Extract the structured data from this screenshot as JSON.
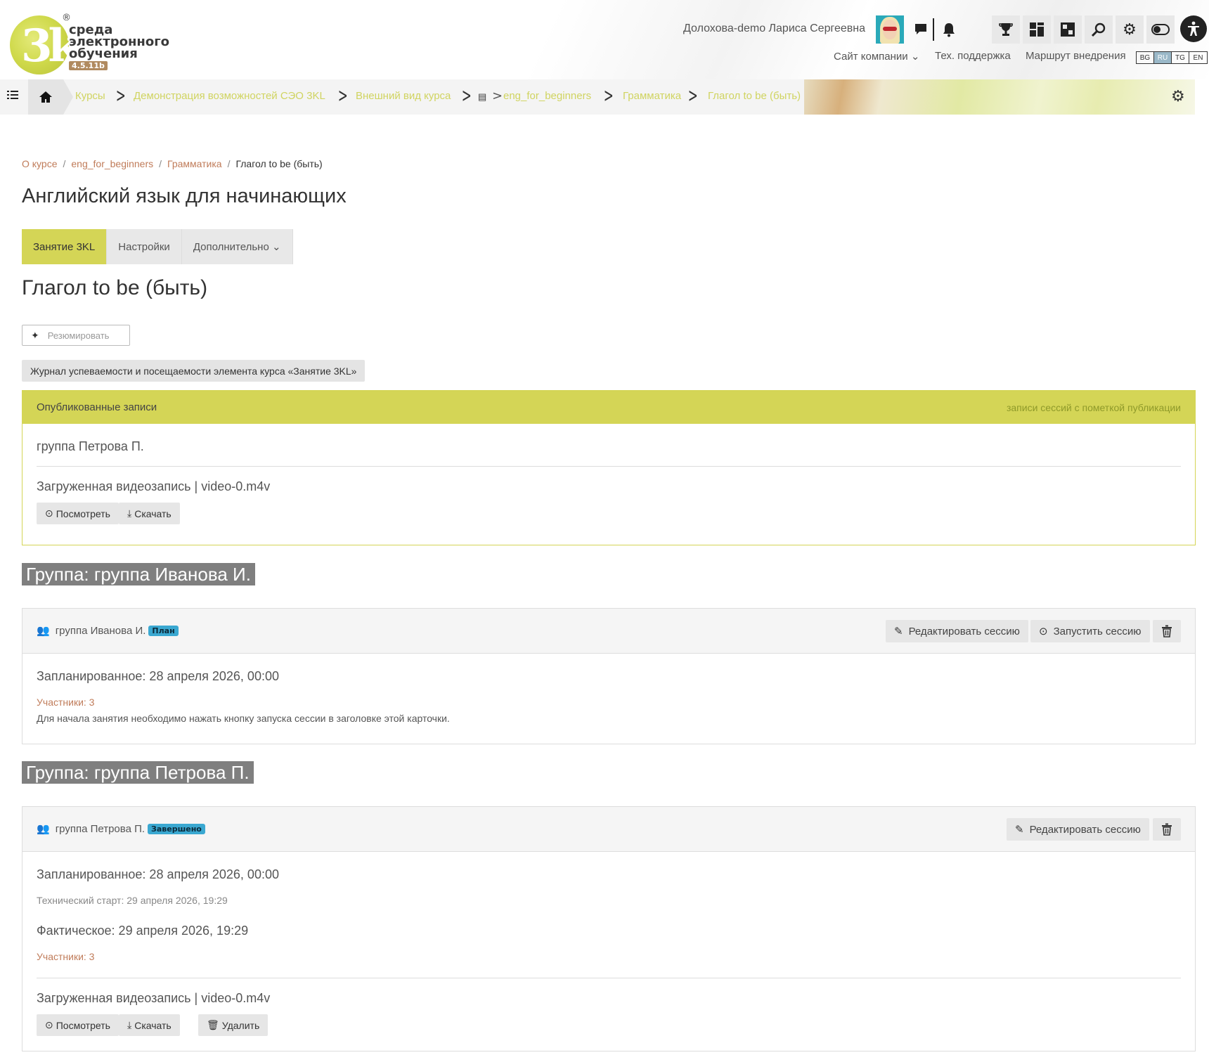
{
  "header": {
    "logo_text_line1": "среда",
    "logo_text_line2": "электронного",
    "logo_text_line3": "обучения",
    "logo_mark": "3k",
    "logo_reg": "®",
    "version": "4.5.11b",
    "user_name": "Долохова-demo Лариса Сергеевна",
    "links": {
      "company_site": "Сайт компании ⌄",
      "support": "Тех. поддержка",
      "route": "Маршрут внедрения"
    },
    "languages": [
      "BG",
      "RU",
      "TG",
      "EN"
    ],
    "active_language": "RU"
  },
  "crumbbar": {
    "items": [
      "Курсы",
      "Демонстрация возможностей СЭО 3KL",
      "Внешний вид курса",
      "eng_for_beginners",
      "Грамматика",
      "Глагол to be (быть)"
    ]
  },
  "page": {
    "breadcrumb": [
      "О курсе",
      "eng_for_beginners",
      "Грамматика",
      "Глагол to be (быть)"
    ],
    "breadcrumb_sep": "/",
    "course_title": "Английский язык для начинающих",
    "tabs": [
      "Занятие 3KL",
      "Настройки",
      "Дополнительно ⌄"
    ],
    "lesson_title": "Глагол to be (быть)",
    "summarize_label": "Резюмировать",
    "journal_label": "Журнал успеваемости и посещаемости элемента курса «Занятие 3KL»"
  },
  "published": {
    "title": "Опубликованные записи",
    "subtitle": "записи сессий с пометкой публикации",
    "group": "группа Петрова П.",
    "video_label": "Загруженная видеозапись | video-0.m4v",
    "view_label": "Посмотреть",
    "download_label": "Скачать"
  },
  "groups": [
    {
      "heading": "Группа: группа Иванова И.",
      "name": "группа Иванова И.",
      "badge": "План",
      "edit_label": "Редактировать сессию",
      "start_label": "Запустить сессию",
      "planned": "Запланированное: 28 апреля 2026, 00:00",
      "participants": "Участники: 3",
      "hint": "Для начала занятия необходимо нажать кнопку запуска сессии в заголовке этой карточки."
    },
    {
      "heading": "Группа: группа Петрова П.",
      "name": "группа Петрова П.",
      "badge": "Завершено",
      "edit_label": "Редактировать сессию",
      "planned": "Запланированное: 28 апреля 2026, 00:00",
      "tech_start": "Технический старт: 29 апреля 2026, 19:29",
      "actual": "Фактическое: 29 апреля 2026, 19:29",
      "participants": "Участники: 3",
      "video_label": "Загруженная видеозапись | video-0.m4v",
      "view_label": "Посмотреть",
      "download_label": "Скачать",
      "delete_label": "Удалить"
    }
  ],
  "colors": {
    "accent": "#d4d556",
    "link": "#c07c5a",
    "badge": "#3aa8d1",
    "heading_bg": "#7f7f7f"
  }
}
